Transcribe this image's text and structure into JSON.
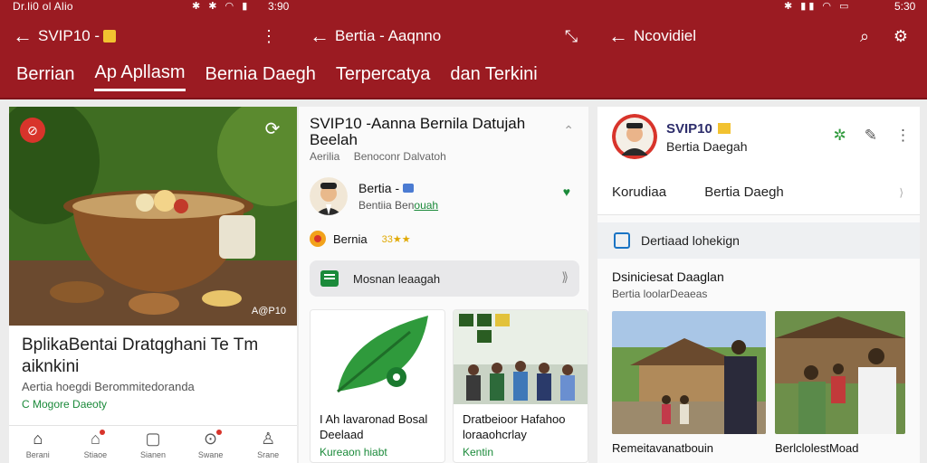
{
  "status": {
    "left_text": "Dr.li0 ol Alio",
    "time_left": "3:90",
    "time_right": "5:30"
  },
  "appbar": {
    "pane1_title": "SVIP10 -",
    "pane2_title": "Bertia - Aaqnno",
    "pane3_title": "Ncovidiel"
  },
  "tabs": [
    "Berrian",
    "Ap Apllasm",
    "Bernia Daegh",
    "Terpercatya",
    "dan Terkini"
  ],
  "left": {
    "hero_credit": "A@P10",
    "headline": "BplikaBentai Dratqghani Te Tm aiknkini",
    "sub": "Aertia hoegdi Berommitedoranda",
    "meta": "Mogore Daeoty"
  },
  "bottom_nav": [
    {
      "label": "Berani",
      "icon": "home-icon"
    },
    {
      "label": "Stiaoe",
      "icon": "house-alert-icon"
    },
    {
      "label": "Sianen",
      "icon": "bookmark-icon"
    },
    {
      "label": "Swane",
      "icon": "location-icon"
    },
    {
      "label": "Srane",
      "icon": "profile-icon"
    }
  ],
  "mid": {
    "title": "SVIP10 -Aanna Bernila Datujah Beelah",
    "sub_a": "Aerilia",
    "sub_b": "Benoconr Dalvatoh",
    "author_name": "Bertia -",
    "author_handle_a": "Bentiia Ben",
    "author_handle_b": "ouah",
    "rating_label": "Bernia",
    "rating_text": "33",
    "cta_label": "Mosnan leaagah",
    "card1_title": "I Ah lavaronad Bosal Deelaad",
    "card1_meta": "Kureaon hiabt",
    "card2_title": "Dratbeioor Hafahoo loraaohcrlay",
    "card2_meta": "Kentin"
  },
  "right": {
    "profile_name": "SVIP10",
    "profile_sub": "Bertia Daegah",
    "tab_a": "Korudiaa",
    "tab_b": "Bertia Daegh",
    "section_label": "Dertiaad lohekign",
    "list_title": "Dsiniciesat Daaglan",
    "list_sub": "Bertia loolarDeaeas",
    "photo1_cap": "Remeitavanatbouin",
    "photo2_cap": "BerlclolestMoad"
  },
  "colors": {
    "brand_red": "#9b1b22",
    "accent_green": "#1b8a3a"
  }
}
